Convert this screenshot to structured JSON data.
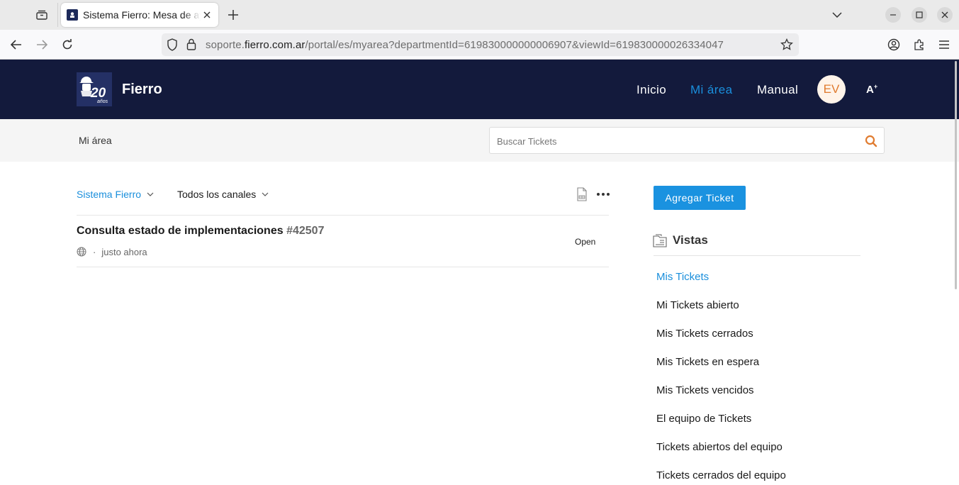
{
  "browser": {
    "tab_title": "Sistema Fierro: Mesa de ayuda",
    "url_prefix": "soporte.",
    "url_host": "fierro.com.ar",
    "url_path": "/portal/es/myarea?departmentId=619830000000006907&viewId=619830000026334047"
  },
  "header": {
    "brand": "Fierro",
    "logo_text": "20 años",
    "nav": {
      "home": "Inicio",
      "my_area": "Mi área",
      "manual": "Manual"
    },
    "avatar_initials": "EV",
    "font_size_label": "A+",
    "accent_color": "#1a8fdc",
    "bg_color": "#131a3c"
  },
  "subheader": {
    "breadcrumb": "Mi área",
    "search_placeholder": "Buscar Tickets"
  },
  "filters": {
    "department": "Sistema Fierro",
    "channel": "Todos los canales"
  },
  "tickets": [
    {
      "subject": "Consulta estado de implementaciones",
      "number": "#42507",
      "channel_icon": "globe-icon",
      "separator": "·",
      "time": "justo ahora",
      "status": "Open"
    }
  ],
  "sidebar": {
    "add_ticket": "Agregar Ticket",
    "views_title": "Vistas",
    "views": [
      "Mis Tickets",
      "Mi Tickets abierto",
      "Mis Tickets cerrados",
      "Mis Tickets en espera",
      "Mis Tickets vencidos",
      "El equipo de Tickets",
      "Tickets abiertos del equipo",
      "Tickets cerrados del equipo"
    ]
  }
}
